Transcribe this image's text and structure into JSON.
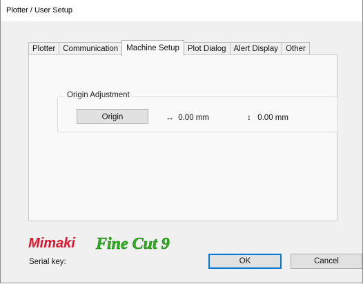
{
  "window": {
    "title": "Plotter / User Setup"
  },
  "tabs": [
    {
      "label": "Plotter",
      "active": false
    },
    {
      "label": "Communication",
      "active": false
    },
    {
      "label": "Machine Setup",
      "active": true
    },
    {
      "label": "Plot Dialog",
      "active": false
    },
    {
      "label": "Alert Display",
      "active": false
    },
    {
      "label": "Other",
      "active": false
    }
  ],
  "origin_adjustment": {
    "group_label": "Origin Adjustment",
    "button_label": "Origin",
    "x_icon": "horizontal-arrow-icon",
    "x_value": "0.00 mm",
    "y_icon": "vertical-arrow-icon",
    "y_value": "0.00 mm"
  },
  "branding": {
    "brand": "Mimaki",
    "product": "Fine Cut 9",
    "brand_color": "#e3142d",
    "product_color": "#2db11e",
    "product_icon": "fine-cut-logo"
  },
  "footer": {
    "serial_label": "Serial key:",
    "ok_label": "OK",
    "cancel_label": "Cancel"
  }
}
